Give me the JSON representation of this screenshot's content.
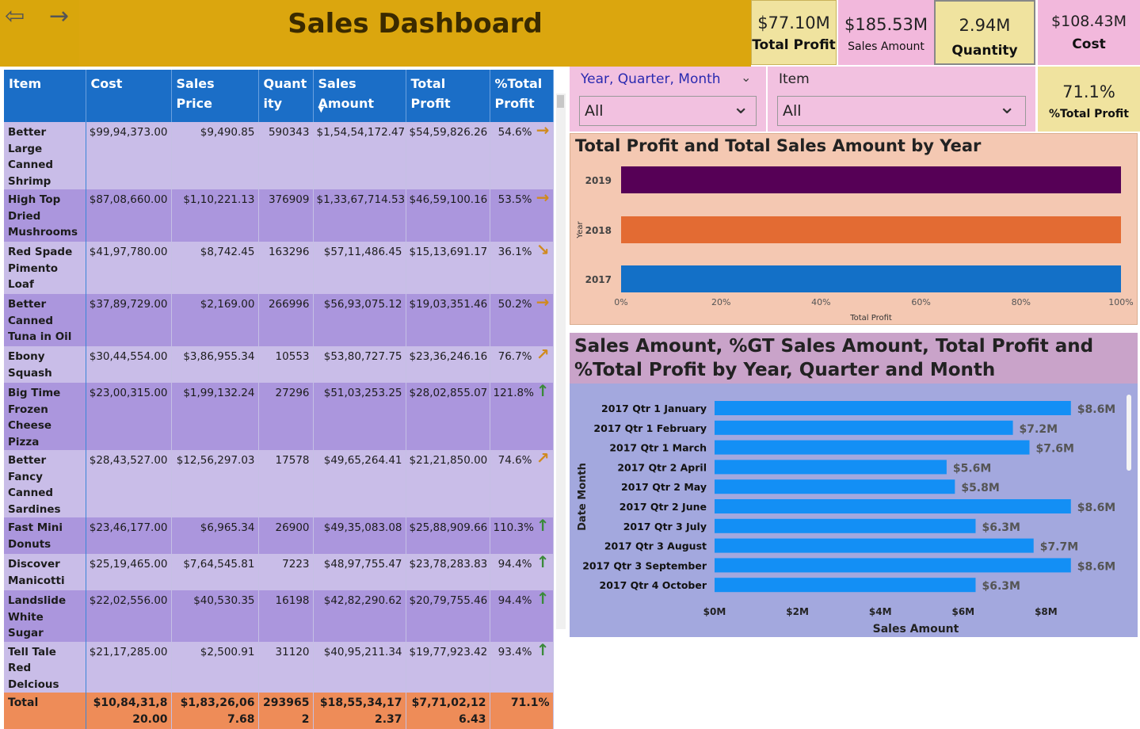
{
  "header": {
    "title": "Sales Dashboard",
    "back_icon": "arrow-circle-left-icon",
    "forward_icon": "arrow-right-icon"
  },
  "kpis": {
    "total_profit": {
      "value": "$77.10M",
      "label": "Total Profit"
    },
    "sales_amount": {
      "value": "$185.53M",
      "label": "Sales Amount"
    },
    "quantity": {
      "value": "2.94M",
      "label": "Quantity"
    },
    "cost": {
      "value": "$108.43M",
      "label": "Cost"
    },
    "pct_total_profit": {
      "value": "71.1%",
      "label": "%Total Profit"
    }
  },
  "slicers": {
    "date": {
      "title": "Year, Quarter, Month",
      "value": "All"
    },
    "item": {
      "title": "Item",
      "value": "All"
    }
  },
  "table": {
    "columns": [
      "Item",
      "Cost",
      "Sales Price",
      "Quant ity",
      "Sales Amount",
      "Total Profit",
      "%Total Profit"
    ],
    "rows": [
      {
        "item": "Better Large Canned Shrimp",
        "cost": "$99,94,373.00",
        "price": "$9,490.85",
        "qty": "590343",
        "sales": "$1,54,54,172.47",
        "profit": "$54,59,826.26",
        "pct": "54.6%",
        "arrow": "right"
      },
      {
        "item": "High Top Dried Mushrooms",
        "cost": "$87,08,660.00",
        "price": "$1,10,221.13",
        "qty": "376909",
        "sales": "$1,33,67,714.53",
        "profit": "$46,59,100.16",
        "pct": "53.5%",
        "arrow": "right"
      },
      {
        "item": "Red Spade Pimento Loaf",
        "cost": "$41,97,780.00",
        "price": "$8,742.45",
        "qty": "163296",
        "sales": "$57,11,486.45",
        "profit": "$15,13,691.17",
        "pct": "36.1%",
        "arrow": "down-right"
      },
      {
        "item": "Better Canned Tuna in Oil",
        "cost": "$37,89,729.00",
        "price": "$2,169.00",
        "qty": "266996",
        "sales": "$56,93,075.12",
        "profit": "$19,03,351.46",
        "pct": "50.2%",
        "arrow": "right"
      },
      {
        "item": "Ebony Squash",
        "cost": "$30,44,554.00",
        "price": "$3,86,955.34",
        "qty": "10553",
        "sales": "$53,80,727.75",
        "profit": "$23,36,246.16",
        "pct": "76.7%",
        "arrow": "up-right"
      },
      {
        "item": "Big Time Frozen Cheese Pizza",
        "cost": "$23,00,315.00",
        "price": "$1,99,132.24",
        "qty": "27296",
        "sales": "$51,03,253.25",
        "profit": "$28,02,855.07",
        "pct": "121.8%",
        "arrow": "up"
      },
      {
        "item": "Better Fancy Canned Sardines",
        "cost": "$28,43,527.00",
        "price": "$12,56,297.03",
        "qty": "17578",
        "sales": "$49,65,264.41",
        "profit": "$21,21,850.00",
        "pct": "74.6%",
        "arrow": "up-right"
      },
      {
        "item": "Fast Mini Donuts",
        "cost": "$23,46,177.00",
        "price": "$6,965.34",
        "qty": "26900",
        "sales": "$49,35,083.08",
        "profit": "$25,88,909.66",
        "pct": "110.3%",
        "arrow": "up"
      },
      {
        "item": "Discover Manicotti",
        "cost": "$25,19,465.00",
        "price": "$7,64,545.81",
        "qty": "7223",
        "sales": "$48,97,755.47",
        "profit": "$23,78,283.83",
        "pct": "94.4%",
        "arrow": "up"
      },
      {
        "item": "Landslide White Sugar",
        "cost": "$22,02,556.00",
        "price": "$40,530.35",
        "qty": "16198",
        "sales": "$42,82,290.62",
        "profit": "$20,79,755.46",
        "pct": "94.4%",
        "arrow": "up"
      },
      {
        "item": "Tell Tale Red Delcious",
        "cost": "$21,17,285.00",
        "price": "$2,500.91",
        "qty": "31120",
        "sales": "$40,95,211.34",
        "profit": "$19,77,923.42",
        "pct": "93.4%",
        "arrow": "up"
      }
    ],
    "total": {
      "item": "Total",
      "cost": "$10,84,31,820.00",
      "price": "$1,83,26,067.68",
      "qty": "2939652",
      "sales": "$18,55,34,172.37",
      "profit": "$7,71,02,126.43",
      "pct": "71.1%"
    },
    "sort_icon": "sort-descending-icon"
  },
  "arrow_colors": {
    "right": "#d08a1e",
    "down-right": "#d08a1e",
    "up-right": "#d08a1e",
    "up": "#3a8a3a"
  },
  "chart_data": [
    {
      "type": "bar",
      "orientation": "horizontal",
      "stacked_100": true,
      "title": "Total Profit and Total Sales Amount by Year",
      "xlabel": "Total Profit",
      "ylabel": "Year",
      "categories": [
        "2019",
        "2018",
        "2017"
      ],
      "colors": [
        "#560056",
        "#e36b33",
        "#1370c7"
      ],
      "values": [
        100,
        100,
        100
      ],
      "xticks": [
        "0%",
        "20%",
        "40%",
        "60%",
        "80%",
        "100%"
      ],
      "xlim": [
        0,
        100
      ]
    },
    {
      "type": "bar",
      "orientation": "horizontal",
      "title": "Sales Amount, %GT Sales Amount, Total Profit and %Total Profit by Year, Quarter and Month",
      "xlabel": "Sales Amount",
      "ylabel": "Date Month",
      "categories": [
        "2017 Qtr 1 January",
        "2017 Qtr 1 February",
        "2017 Qtr 1 March",
        "2017 Qtr 2 April",
        "2017 Qtr 2 May",
        "2017 Qtr 2 June",
        "2017 Qtr 3 July",
        "2017 Qtr 3 August",
        "2017 Qtr 3 September",
        "2017 Qtr 4 October"
      ],
      "values": [
        8.6,
        7.2,
        7.6,
        5.6,
        5.8,
        8.6,
        6.3,
        7.7,
        8.6,
        6.3
      ],
      "labels": [
        "$8.6M",
        "$7.2M",
        "$7.6M",
        "$5.6M",
        "$5.8M",
        "$8.6M",
        "$6.3M",
        "$7.7M",
        "$8.6M",
        "$6.3M"
      ],
      "xticks": [
        "$0M",
        "$2M",
        "$4M",
        "$6M",
        "$8M"
      ],
      "xlim": [
        0,
        8.6
      ],
      "color": "#138ff5"
    }
  ]
}
